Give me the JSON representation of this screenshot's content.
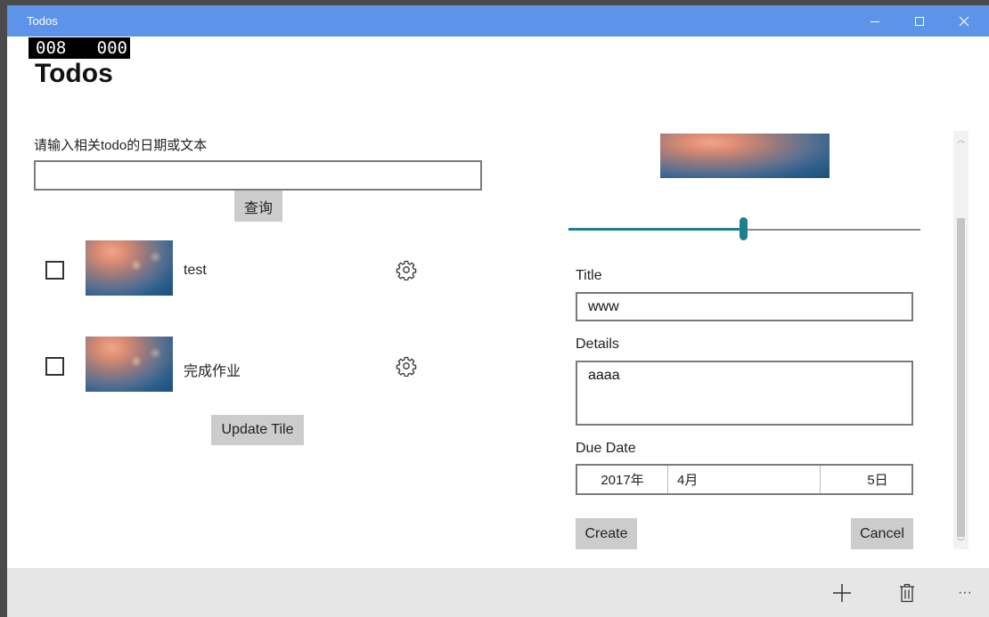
{
  "window": {
    "title": "Todos"
  },
  "counter": {
    "text": "008   000"
  },
  "page": {
    "title": "Todos"
  },
  "search": {
    "label": "请输入相关todo的日期或文本",
    "value": "",
    "placeholder": "",
    "button_label": "查询"
  },
  "todos": [
    {
      "title": "test",
      "checked": false
    },
    {
      "title": "完成作业",
      "checked": false
    }
  ],
  "update_tile_label": "Update Tile",
  "editor": {
    "slider_value": 0.5,
    "title_label": "Title",
    "title_value": "www",
    "details_label": "Details",
    "details_value": "aaaa",
    "due_date_label": "Due Date",
    "due_date": {
      "year": "2017年",
      "month": "4月",
      "day": "5日"
    },
    "create_label": "Create",
    "cancel_label": "Cancel"
  },
  "appbar": {
    "icons": [
      "add-icon",
      "delete-icon",
      "more-icon"
    ],
    "more_text": "···"
  },
  "colors": {
    "titlebar": "#5d93e8",
    "accent": "#1e7f8e",
    "appbar": "#e6e6e6",
    "button": "#cccccc"
  }
}
